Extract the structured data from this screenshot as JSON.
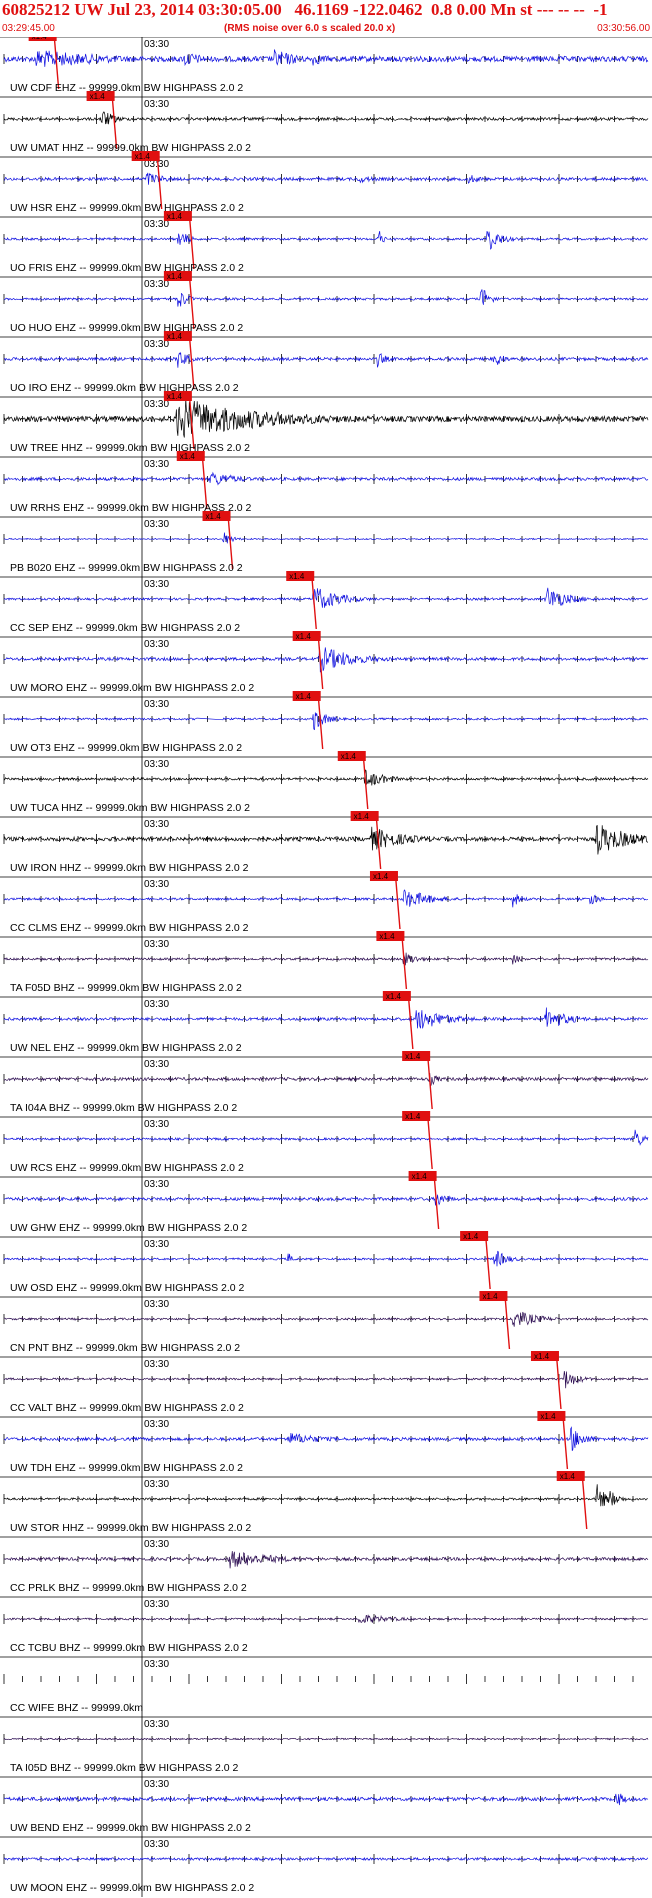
{
  "header": {
    "title": "60825212 UW Jul 23, 2014 03:30:05.00   46.1169 -122.0462  0.8 0.00 Mn st --- -- --  -1",
    "start_time": "03:29:45.00",
    "end_time": "03:30:56.00",
    "rms_note": "(RMS noise over 6.0 s scaled 20.0 x)"
  },
  "minute_label": "03:30",
  "pick_label": "x1.4",
  "colors": {
    "red": "#e01010",
    "blue": "#1010e0",
    "black": "#000000",
    "purple": "#2a0a50"
  },
  "traces": [
    {
      "label": "UW CDF EHZ -- 99999.0km BW  HIGHPASS  2.0  2",
      "color": "blue",
      "amp": 0.55,
      "pick": 0.06,
      "bursts": [
        [
          0.05,
          0.18,
          0.7
        ],
        [
          0.28,
          0.05,
          0.6
        ],
        [
          0.42,
          0.06,
          0.7
        ],
        [
          0.48,
          0.04,
          0.5
        ]
      ]
    },
    {
      "label": "UW UMAT HHZ -- 99999.0km BW  HIGHPASS  2.0  2",
      "color": "black",
      "amp": 0.28,
      "pick": 0.15,
      "bursts": [
        [
          0.15,
          0.03,
          0.8
        ]
      ]
    },
    {
      "label": "UW HSR EHZ -- 99999.0km BW  HIGHPASS  2.0  2",
      "color": "blue",
      "amp": 0.3,
      "pick": 0.22,
      "bursts": [
        [
          0.22,
          0.04,
          0.6
        ],
        [
          0.55,
          0.05,
          0.3
        ],
        [
          0.72,
          0.03,
          0.4
        ]
      ]
    },
    {
      "label": "UO FRIS EHZ -- 99999.0km BW  HIGHPASS  2.0  2",
      "color": "blue",
      "amp": 0.22,
      "pick": 0.27,
      "bursts": [
        [
          0.27,
          0.02,
          0.9
        ],
        [
          0.58,
          0.01,
          1.0
        ],
        [
          0.75,
          0.03,
          1.0
        ]
      ]
    },
    {
      "label": "UO HUO EHZ -- 99999.0km BW  HIGHPASS  2.0  2",
      "color": "blue",
      "amp": 0.22,
      "pick": 0.27,
      "bursts": [
        [
          0.27,
          0.02,
          0.9
        ],
        [
          0.74,
          0.02,
          1.0
        ]
      ]
    },
    {
      "label": "UO IRO EHZ -- 99999.0km BW  HIGHPASS  2.0  2",
      "color": "blue",
      "amp": 0.3,
      "pick": 0.27,
      "bursts": [
        [
          0.27,
          0.02,
          0.9
        ],
        [
          0.58,
          0.02,
          0.6
        ],
        [
          0.76,
          0.02,
          0.8
        ]
      ]
    },
    {
      "label": "UW TREE HHZ -- 99999.0km BW  HIGHPASS  2.0  2",
      "color": "black",
      "amp": 0.55,
      "pick": 0.27,
      "bursts": [
        [
          0.27,
          0.2,
          1.6
        ]
      ]
    },
    {
      "label": "UW RRHS EHZ -- 99999.0km BW  HIGHPASS  2.0  2",
      "color": "blue",
      "amp": 0.3,
      "pick": 0.29,
      "bursts": [
        [
          0.32,
          0.06,
          0.6
        ]
      ]
    },
    {
      "label": "PB B020 EHZ -- 99999.0km BW  HIGHPASS  2.0  2",
      "color": "blue",
      "amp": 0.12,
      "pick": 0.33,
      "bursts": [
        [
          0.34,
          0.02,
          0.6
        ]
      ]
    },
    {
      "label": "CC SEP EHZ -- 99999.0km BW  HIGHPASS  2.0  2",
      "color": "blue",
      "amp": 0.22,
      "pick": 0.46,
      "bursts": [
        [
          0.48,
          0.06,
          1.0
        ],
        [
          0.84,
          0.05,
          1.0
        ]
      ]
    },
    {
      "label": "UW MORO EHZ -- 99999.0km BW  HIGHPASS  2.0  2",
      "color": "blue",
      "amp": 0.3,
      "pick": 0.47,
      "bursts": [
        [
          0.49,
          0.08,
          1.0
        ]
      ]
    },
    {
      "label": "UW OT3 EHZ -- 99999.0km BW  HIGHPASS  2.0  2",
      "color": "blue",
      "amp": 0.2,
      "pick": 0.47,
      "bursts": [
        [
          0.48,
          0.03,
          0.9
        ]
      ],
      "gap": [
        0.3,
        0.34
      ]
    },
    {
      "label": "UW TUCA HHZ -- 99999.0km BW  HIGHPASS  2.0  2",
      "color": "black",
      "amp": 0.25,
      "pick": 0.54,
      "bursts": [
        [
          0.56,
          0.05,
          0.7
        ]
      ]
    },
    {
      "label": "UW IRON HHZ -- 99999.0km BW  HIGHPASS  2.0  2",
      "color": "black",
      "amp": 0.4,
      "pick": 0.56,
      "bursts": [
        [
          0.57,
          0.08,
          0.9
        ],
        [
          0.92,
          0.08,
          1.2
        ]
      ]
    },
    {
      "label": "CC CLMS EHZ -- 99999.0km BW  HIGHPASS  2.0  2",
      "color": "blue",
      "amp": 0.22,
      "pick": 0.59,
      "bursts": [
        [
          0.62,
          0.06,
          0.8
        ],
        [
          0.79,
          0.02,
          0.6
        ],
        [
          0.91,
          0.02,
          0.6
        ]
      ]
    },
    {
      "label": "TA F05D BHZ -- 99999.0km BW  HIGHPASS  2.0  2",
      "color": "purple",
      "amp": 0.22,
      "pick": 0.6,
      "bursts": [
        [
          0.62,
          0.03,
          0.6
        ],
        [
          0.79,
          0.02,
          0.4
        ]
      ]
    },
    {
      "label": "UW NEL EHZ -- 99999.0km BW  HIGHPASS  2.0  2",
      "color": "blue",
      "amp": 0.28,
      "pick": 0.61,
      "bursts": [
        [
          0.64,
          0.07,
          0.9
        ],
        [
          0.84,
          0.05,
          0.9
        ]
      ]
    },
    {
      "label": "TA I04A BHZ -- 99999.0km BW  HIGHPASS  2.0  2",
      "color": "purple",
      "amp": 0.3,
      "pick": 0.64,
      "bursts": [
        [
          0.66,
          0.02,
          0.6
        ]
      ]
    },
    {
      "label": "UW RCS EHZ -- 99999.0km BW  HIGHPASS  2.0  2",
      "color": "blue",
      "amp": 0.22,
      "pick": 0.64,
      "bursts": [
        [
          0.98,
          0.02,
          0.8
        ]
      ]
    },
    {
      "label": "UW GHW EHZ -- 99999.0km BW  HIGHPASS  2.0  2",
      "color": "blue",
      "amp": 0.3,
      "pick": 0.65,
      "bursts": [
        [
          0.67,
          0.03,
          0.6
        ]
      ]
    },
    {
      "label": "UW OSD EHZ -- 99999.0km BW  HIGHPASS  2.0  2",
      "color": "blue",
      "amp": 0.2,
      "pick": 0.73,
      "bursts": [
        [
          0.76,
          0.03,
          0.8
        ],
        [
          0.44,
          0.01,
          0.6
        ]
      ]
    },
    {
      "label": "CN PNT BHZ -- 99999.0km BW  HIGHPASS  2.0  2",
      "color": "purple",
      "amp": 0.2,
      "pick": 0.76,
      "bursts": [
        [
          0.79,
          0.05,
          0.8
        ]
      ]
    },
    {
      "label": "CC VALT BHZ -- 99999.0km BW  HIGHPASS  2.0  2",
      "color": "purple",
      "amp": 0.2,
      "pick": 0.84,
      "bursts": [
        [
          0.87,
          0.03,
          0.8
        ]
      ]
    },
    {
      "label": "UW TDH EHZ -- 99999.0km BW  HIGHPASS  2.0  2",
      "color": "blue",
      "amp": 0.3,
      "pick": 0.85,
      "bursts": [
        [
          0.44,
          0.08,
          0.5
        ],
        [
          0.88,
          0.03,
          1.0
        ]
      ]
    },
    {
      "label": "UW STOR HHZ -- 99999.0km BW  HIGHPASS  2.0  2",
      "color": "black",
      "amp": 0.22,
      "pick": 0.88,
      "bursts": [
        [
          0.92,
          0.02,
          1.2
        ],
        [
          0.94,
          0.02,
          0.8
        ]
      ]
    },
    {
      "label": "CC PRLK BHZ -- 99999.0km BW  HIGHPASS  2.0  2",
      "color": "purple",
      "amp": 0.3,
      "pick": null,
      "bursts": [
        [
          0.35,
          0.1,
          0.7
        ]
      ]
    },
    {
      "label": "CC TCBU BHZ -- 99999.0km BW  HIGHPASS  2.0  2",
      "color": "purple",
      "amp": 0.18,
      "pick": null,
      "bursts": [
        [
          0.55,
          0.08,
          0.4
        ]
      ]
    },
    {
      "label": "CC WIFE BHZ -- 99999.0km",
      "color": "purple",
      "amp": 0,
      "pick": null,
      "bursts": []
    },
    {
      "label": "TA I05D BHZ -- 99999.0km BW  HIGHPASS  2.0  2",
      "color": "purple",
      "amp": 0.15,
      "pick": null,
      "bursts": []
    },
    {
      "label": "UW BEND EHZ -- 99999.0km BW  HIGHPASS  2.0  2",
      "color": "blue",
      "amp": 0.35,
      "pick": null,
      "bursts": [
        [
          0.95,
          0.02,
          0.7
        ]
      ]
    },
    {
      "label": "UW MOON EHZ -- 99999.0km BW  HIGHPASS  2.0  2",
      "color": "blue",
      "amp": 0.25,
      "pick": null,
      "bursts": []
    }
  ]
}
